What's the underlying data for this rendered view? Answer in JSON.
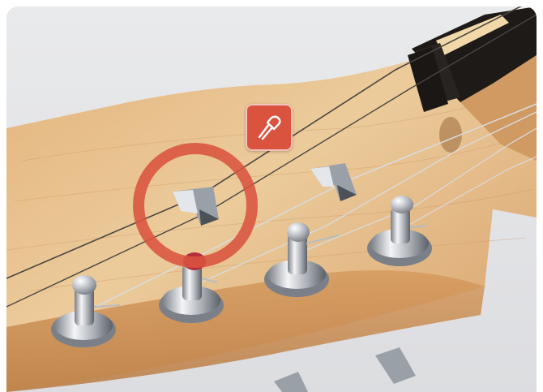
{
  "scene": {
    "subject": "guitar-headstock",
    "colors": {
      "background": "#e7e8ea",
      "wood_light": "#e7bf8e",
      "wood_dark": "#c98f55",
      "fretboard": "#1e1a18",
      "nut": "#f1d8a8",
      "chrome": "#c9ccd1",
      "string": "#3a3a3a",
      "highlight_ring": "#d9533f",
      "badge": "#d9533f"
    }
  },
  "overlay": {
    "highlight": {
      "target": "string-tree",
      "shape": "ring"
    },
    "badge": {
      "icon": "screwdriver-icon"
    }
  }
}
